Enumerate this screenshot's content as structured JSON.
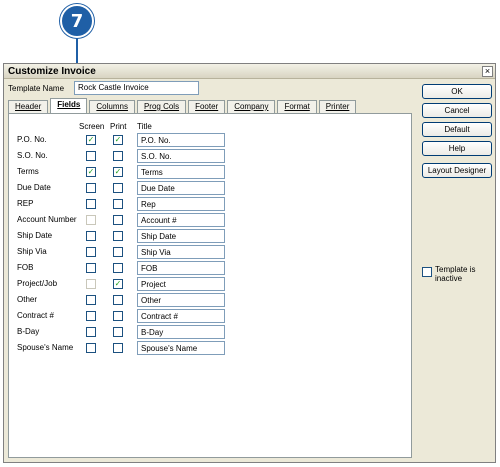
{
  "callout": {
    "number": "7",
    "color": "#1f5fa6"
  },
  "dialog": {
    "title": "Customize Invoice",
    "close_glyph": "×",
    "template_name_label": "Template Name",
    "template_name_value": "Rock Castle Invoice"
  },
  "tabs": [
    {
      "label": "Header",
      "active": false
    },
    {
      "label": "Fields",
      "active": true
    },
    {
      "label": "Columns",
      "active": false
    },
    {
      "label": "Prog Cols",
      "active": false
    },
    {
      "label": "Footer",
      "active": false
    },
    {
      "label": "Company",
      "active": false
    },
    {
      "label": "Format",
      "active": false
    },
    {
      "label": "Printer",
      "active": false
    }
  ],
  "headers": {
    "screen": "Screen",
    "print": "Print",
    "title": "Title"
  },
  "fields": [
    {
      "label": "P.O. No.",
      "screen": true,
      "print": true,
      "title": "P.O. No.",
      "screen_enabled": true
    },
    {
      "label": "S.O. No.",
      "screen": false,
      "print": false,
      "title": "S.O. No.",
      "screen_enabled": true
    },
    {
      "label": "Terms",
      "screen": true,
      "print": true,
      "title": "Terms",
      "screen_enabled": true
    },
    {
      "label": "Due Date",
      "screen": false,
      "print": false,
      "title": "Due Date",
      "screen_enabled": true
    },
    {
      "label": "REP",
      "screen": false,
      "print": false,
      "title": "Rep",
      "screen_enabled": true
    },
    {
      "label": "Account Number",
      "screen": false,
      "print": false,
      "title": "Account #",
      "screen_enabled": false
    },
    {
      "label": "Ship Date",
      "screen": false,
      "print": false,
      "title": "Ship Date",
      "screen_enabled": true
    },
    {
      "label": "Ship Via",
      "screen": false,
      "print": false,
      "title": "Ship Via",
      "screen_enabled": true
    },
    {
      "label": "FOB",
      "screen": false,
      "print": false,
      "title": "FOB",
      "screen_enabled": true
    },
    {
      "label": "Project/Job",
      "screen": false,
      "print": true,
      "title": "Project",
      "screen_enabled": false
    },
    {
      "label": "Other",
      "screen": false,
      "print": false,
      "title": "Other",
      "screen_enabled": true
    },
    {
      "label": "Contract #",
      "screen": false,
      "print": false,
      "title": "Contract #",
      "screen_enabled": true
    },
    {
      "label": "B-Day",
      "screen": false,
      "print": false,
      "title": "B-Day",
      "screen_enabled": true
    },
    {
      "label": "Spouse's Name",
      "screen": false,
      "print": false,
      "title": "Spouse's Name",
      "screen_enabled": true
    }
  ],
  "buttons": {
    "ok": "OK",
    "cancel": "Cancel",
    "default": "Default",
    "help": "Help",
    "layout_designer": "Layout Designer"
  },
  "template_inactive": {
    "label": "Template is inactive",
    "checked": false
  },
  "check_glyph": "✓"
}
